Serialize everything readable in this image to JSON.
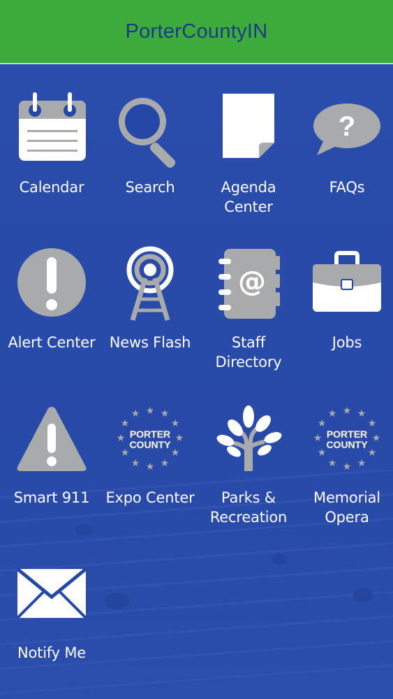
{
  "header": {
    "title": "PorterCountyIN"
  },
  "tiles": [
    {
      "label_1": "Calendar",
      "label_2": "",
      "icon": "calendar-icon"
    },
    {
      "label_1": "Search",
      "label_2": "",
      "icon": "search-icon"
    },
    {
      "label_1": "Agenda",
      "label_2": "Center",
      "icon": "document-icon"
    },
    {
      "label_1": "FAQs",
      "label_2": "",
      "icon": "question-bubble-icon"
    },
    {
      "label_1": "Alert Center",
      "label_2": "",
      "icon": "alert-icon"
    },
    {
      "label_1": "News Flash",
      "label_2": "",
      "icon": "broadcast-tower-icon"
    },
    {
      "label_1": "Staff",
      "label_2": "Directory",
      "icon": "address-book-icon"
    },
    {
      "label_1": "Jobs",
      "label_2": "",
      "icon": "briefcase-icon"
    },
    {
      "label_1": "Smart 911",
      "label_2": "",
      "icon": "warning-triangle-icon"
    },
    {
      "label_1": "Expo Center",
      "label_2": "",
      "icon": "porter-county-seal-icon"
    },
    {
      "label_1": "Parks &",
      "label_2": "Recreation",
      "icon": "tree-icon"
    },
    {
      "label_1": "Memorial",
      "label_2": "Opera",
      "icon": "porter-county-seal-icon"
    },
    {
      "label_1": "Notify Me",
      "label_2": "",
      "icon": "envelope-icon"
    }
  ],
  "seal_text": {
    "line_1": "PORTER",
    "line_2": "COUNTY"
  },
  "colors": {
    "header_bg": "#3dab3a",
    "header_text": "#1d3a8a",
    "content_bg": "#2a4cab",
    "icon_fill": "#a9aaac",
    "icon_white": "#ffffff"
  }
}
